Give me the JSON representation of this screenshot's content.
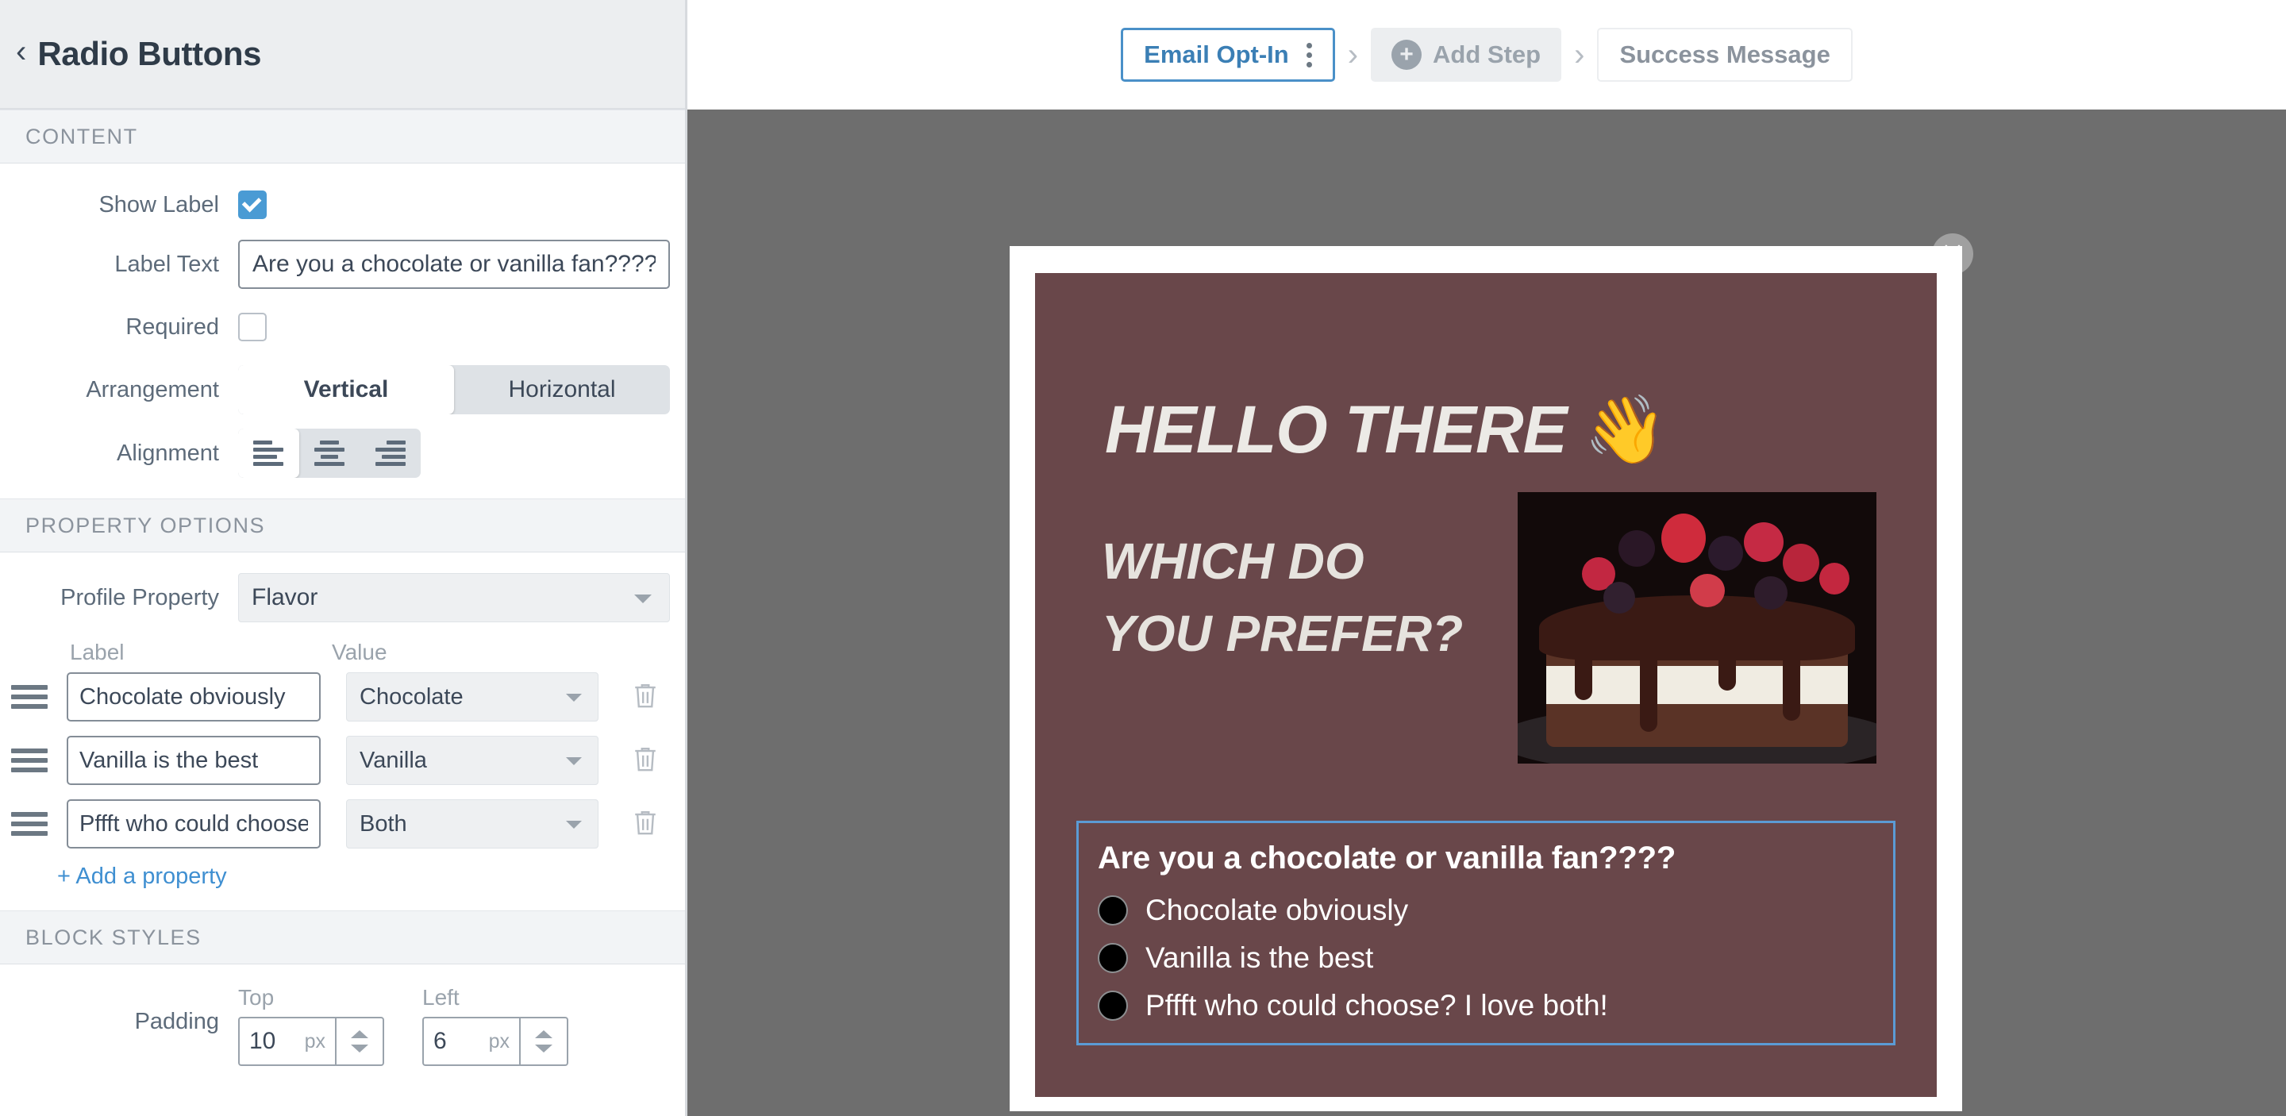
{
  "sidebar": {
    "back_icon": "chevron-left-icon",
    "title": "Radio Buttons",
    "sections": {
      "content": "CONTENT",
      "property_options": "PROPERTY OPTIONS",
      "block_styles": "BLOCK STYLES"
    },
    "fields": {
      "show_label": {
        "label": "Show Label",
        "checked": true
      },
      "label_text": {
        "label": "Label Text",
        "value": "Are you a chocolate or vanilla fan????"
      },
      "required": {
        "label": "Required",
        "checked": false
      },
      "arrangement": {
        "label": "Arrangement",
        "options": [
          "Vertical",
          "Horizontal"
        ],
        "selected": "Vertical"
      },
      "alignment": {
        "label": "Alignment",
        "options": [
          "align-left",
          "align-center",
          "align-right"
        ],
        "selected": "align-left"
      },
      "profile_property": {
        "label": "Profile Property",
        "value": "Flavor"
      }
    },
    "property_table": {
      "header_label": "Label",
      "header_value": "Value",
      "rows": [
        {
          "label": "Chocolate obviously",
          "value": "Chocolate"
        },
        {
          "label": "Vanilla is the best",
          "value": "Vanilla"
        },
        {
          "label": "Pffft who could choose",
          "value": "Both"
        }
      ],
      "add_link": "+ Add a property",
      "trash_icon": "trash-icon",
      "grip_icon": "drag-handle-icon"
    },
    "padding": {
      "label": "Padding",
      "top": {
        "caption": "Top",
        "value": "10",
        "unit": "px"
      },
      "left": {
        "caption": "Left",
        "value": "6",
        "unit": "px"
      }
    }
  },
  "topbar": {
    "steps": [
      {
        "label": "Email Opt-In",
        "state": "active",
        "menu_icon": "kebab-menu-icon"
      },
      {
        "label": "Add Step",
        "state": "add",
        "icon": "plus-circle-icon"
      },
      {
        "label": "Success Message",
        "state": "plain"
      }
    ],
    "separator": "›"
  },
  "preview": {
    "close_icon": "close-icon",
    "headline": "HELLO THERE",
    "headline_emoji": "👋",
    "subhead": "WHICH DO YOU PREFER?",
    "image_alt": "chocolate-berry-cake-photo",
    "question": "Are you a chocolate or vanilla fan????",
    "choices": [
      "Chocolate obviously",
      "Vanilla is the best",
      "Pffft who could choose? I love both!"
    ],
    "colors": {
      "background": "#69474a",
      "accent_border": "#5b9bd5",
      "text": "#ffffff",
      "canvas": "#6e6e6e"
    }
  }
}
